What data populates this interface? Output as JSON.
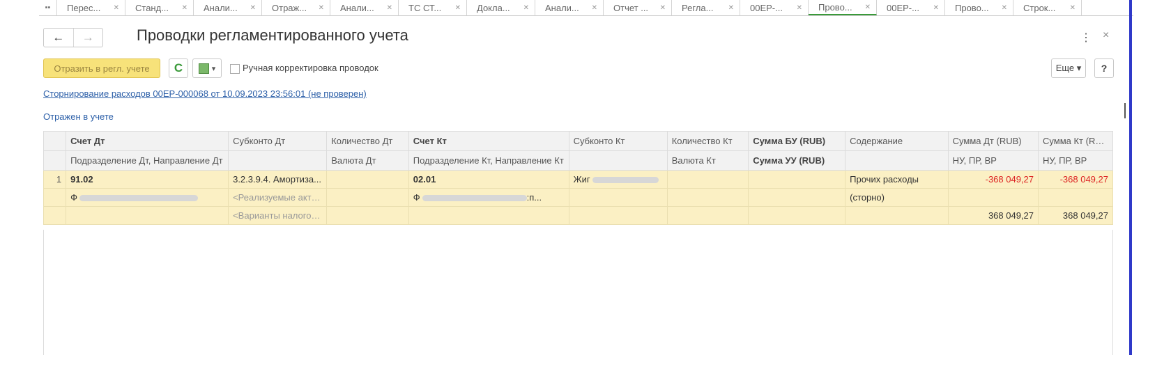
{
  "tabs": [
    {
      "label": "Перес..."
    },
    {
      "label": "Станд..."
    },
    {
      "label": "Анали..."
    },
    {
      "label": "Отраж..."
    },
    {
      "label": "Анали..."
    },
    {
      "label": "ТС СТ..."
    },
    {
      "label": "Докла..."
    },
    {
      "label": "Анали..."
    },
    {
      "label": "Отчет ..."
    },
    {
      "label": "Регла..."
    },
    {
      "label": "00ЕР-..."
    },
    {
      "label": "Прово..."
    },
    {
      "label": "00ЕР-..."
    },
    {
      "label": "Прово..."
    },
    {
      "label": "Строк..."
    }
  ],
  "header": {
    "title": "Проводки регламентированного учета",
    "back": "←",
    "forward": "→",
    "menu": "⋮",
    "close": "×"
  },
  "toolbar": {
    "post_button": "Отразить в регл. учете",
    "refresh": "C",
    "dropdown_arrow": "▾",
    "manual_label": "Ручная корректировка проводок",
    "more_button": "Еще ▾",
    "help_button": "?"
  },
  "document_link": "Сторнирование расходов 00ЕР-000068 от 10.09.2023 23:56:01 (не проверен)",
  "status_text": "Отражен в учете",
  "table": {
    "header1": [
      "Счет Дт",
      "Субконто Дт",
      "Количество Дт",
      "Счет Кт",
      "Субконто Кт",
      "Количество Кт",
      "Сумма БУ (RUB)",
      "Содержание",
      "Сумма Дт (RUB)",
      "Сумма Кт (RUB)"
    ],
    "header2": [
      "Подразделение Дт, Направление Дт",
      "",
      "Валюта Дт",
      "Подразделение Кт, Направление Кт",
      "",
      "Валюта Кт",
      "Сумма УУ (RUB)",
      "",
      "НУ, ПР, ВР",
      "НУ, ПР, ВР"
    ],
    "row": {
      "n": "1",
      "account_dt": "91.02",
      "subconto_dt_1": "3.2.3.9.4. Амортиза...",
      "account_kt": "02.01",
      "subconto_kt_1": "Жиг",
      "content_1": "Прочих расходы",
      "content_2": "(сторно)",
      "sum_dt": "-368 049,27",
      "sum_kt": "-368 049,27",
      "div_dt_prefix": "Ф",
      "subconto_dt_2": "<Реализуемые акти...",
      "div_kt_prefix": "Ф",
      "div_kt_suffix": ":п...",
      "subconto_dt_3": "<Варианты налогоо...",
      "sum_dt_nu": "368 049,27",
      "sum_kt_nu": "368 049,27"
    }
  },
  "colors": {
    "accent_yellow": "#f7e27a",
    "row_highlight": "#fbf0c4",
    "link_blue": "#2c5fa8",
    "negative_red": "#dd2222",
    "active_tab_green": "#3a9a3a"
  }
}
